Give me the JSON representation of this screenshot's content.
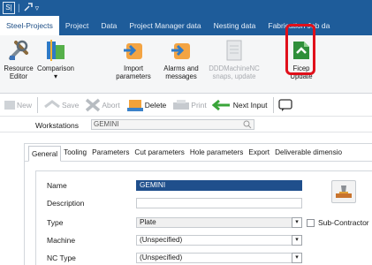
{
  "titlebar": {
    "app_icon": "S|",
    "separator": "|",
    "quick_icon": "tools-icon",
    "quick_arrow": "▿"
  },
  "tabs": [
    {
      "label": "Steel-Projects",
      "active": true
    },
    {
      "label": "Project",
      "active": false
    },
    {
      "label": "Data",
      "active": false
    },
    {
      "label": "Project Manager data",
      "active": false
    },
    {
      "label": "Nesting data",
      "active": false
    },
    {
      "label": "Fabrication Job da",
      "active": false
    }
  ],
  "ribbon": {
    "resource_editor": "Resource\nEditor",
    "comparison": "Comparison",
    "comparison_arrow": "▾",
    "import_parameters": "Import\nparameters",
    "alarms_messages": "Alarms and\nmessages",
    "ddd_machine": "DDDMachineNC\nsnaps, update",
    "ficep_update": "Ficep\nUpdate"
  },
  "toolbar": {
    "new": "New",
    "save": "Save",
    "abort": "Abort",
    "delete": "Delete",
    "print": "Print",
    "next_input": "Next Input"
  },
  "workstations": {
    "label": "Workstations",
    "value": "GEMINI"
  },
  "panel_tabs": [
    {
      "label": "General",
      "active": true
    },
    {
      "label": "Tooling",
      "active": false
    },
    {
      "label": "Parameters",
      "active": false
    },
    {
      "label": "Cut parameters",
      "active": false
    },
    {
      "label": "Hole parameters",
      "active": false
    },
    {
      "label": "Export",
      "active": false
    },
    {
      "label": "Deliverable dimensio",
      "active": false
    }
  ],
  "form": {
    "name_label": "Name",
    "name_value": "GEMINI",
    "description_label": "Description",
    "description_value": "",
    "type_label": "Type",
    "type_value": "Plate",
    "subcontractor_label": "Sub-Contractor",
    "machine_label": "Machine",
    "machine_value": "(Unspecified)",
    "nctype_label": "NC Type",
    "nctype_value": "(Unspecified)",
    "dropdown_glyph": "▾"
  },
  "colors": {
    "ribbon_blue": "#1e5c9a",
    "highlight_red": "#e0101b",
    "selection_blue": "#1f4f8c"
  }
}
